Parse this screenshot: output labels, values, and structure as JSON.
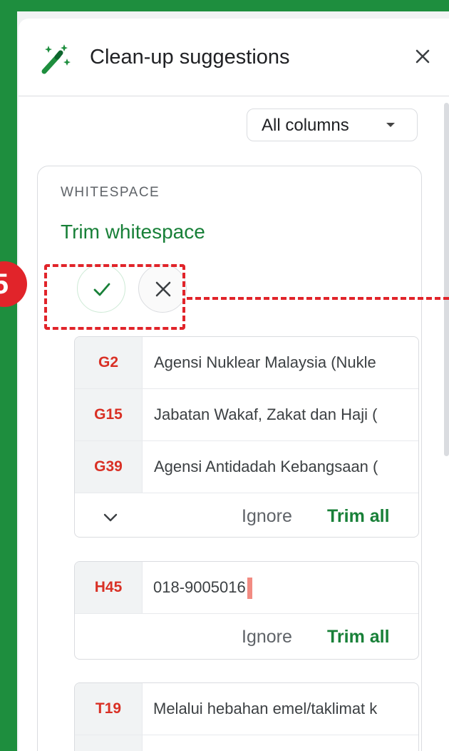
{
  "panel": {
    "title": "Clean-up suggestions",
    "column_filter": "All columns"
  },
  "suggestion": {
    "category": "WHITESPACE",
    "title": "Trim whitespace"
  },
  "annotation": {
    "step": "5"
  },
  "groups": [
    {
      "rows": [
        {
          "ref": "G2",
          "value": "Agensi Nuklear Malaysia (Nukle"
        },
        {
          "ref": "G15",
          "value": "Jabatan Wakaf, Zakat dan Haji ("
        },
        {
          "ref": "G39",
          "value": "Agensi Antidadah Kebangsaan ("
        }
      ],
      "ignore_label": "Ignore",
      "trim_label": "Trim all"
    },
    {
      "rows": [
        {
          "ref": "H45",
          "value": "018-9005016"
        }
      ],
      "ignore_label": "Ignore",
      "trim_label": "Trim all"
    },
    {
      "rows": [
        {
          "ref": "T19",
          "value": "Melalui hebahan emel/taklimat k"
        }
      ]
    }
  ],
  "colors": {
    "accent": "#188038",
    "error": "#d93025",
    "highlight": "#e1242a",
    "frame": "#1e8e3e"
  }
}
